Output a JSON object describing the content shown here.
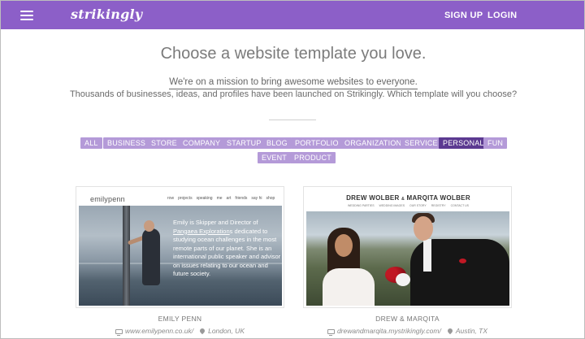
{
  "navbar": {
    "logo": "strikingly",
    "signup_label": "SIGN UP",
    "login_label": "LOGIN",
    "color": "#8c5fc8"
  },
  "hero": {
    "headline": "Choose a website template you love.",
    "mission": "We're on a mission to bring awesome websites to everyone.",
    "subline": "Thousands of businesses, ideas, and profiles have been launched on Strikingly. Which template will you choose?"
  },
  "filters": {
    "items": [
      "ALL",
      "BUSINESS",
      "STORE",
      "COMPANY",
      "STARTUP",
      "BLOG",
      "PORTFOLIO",
      "ORGANIZATION",
      "SERVICE",
      "PERSONAL",
      "FUN",
      "EVENT",
      "PRODUCT"
    ],
    "active": "PERSONAL",
    "color": "#b49ad8",
    "active_color": "#5c3a91"
  },
  "templates": [
    {
      "name": "EMILY PENN",
      "url": "www.emilypenn.co.uk/",
      "location": "London, UK",
      "preview": {
        "brand": "emilypenn",
        "nav": [
          "row",
          "projects",
          "speaking",
          "me",
          "art",
          "friends",
          "say hi",
          "shop"
        ],
        "text_before": "Emily is Skipper and Director of ",
        "text_link": "Pangaea Exploration",
        "text_after": "s dedicated to studying ocean challenges in the most remote parts of our planet. She is an international public speaker and advisor on issues relating to our ocean and future society."
      }
    },
    {
      "name": "DREW & MARQITA",
      "url": "drewandmarqita.mystrikingly.com/",
      "location": "Austin, TX",
      "preview": {
        "title_left": "DREW WOLBER",
        "title_amp": "&",
        "title_right": "MARQITA WOLBER",
        "nav": [
          "WEDDING PARTIES",
          "WEDDING IMAGES",
          "OUR STORY",
          "REGISTRY",
          "CONTACT US"
        ]
      }
    }
  ]
}
